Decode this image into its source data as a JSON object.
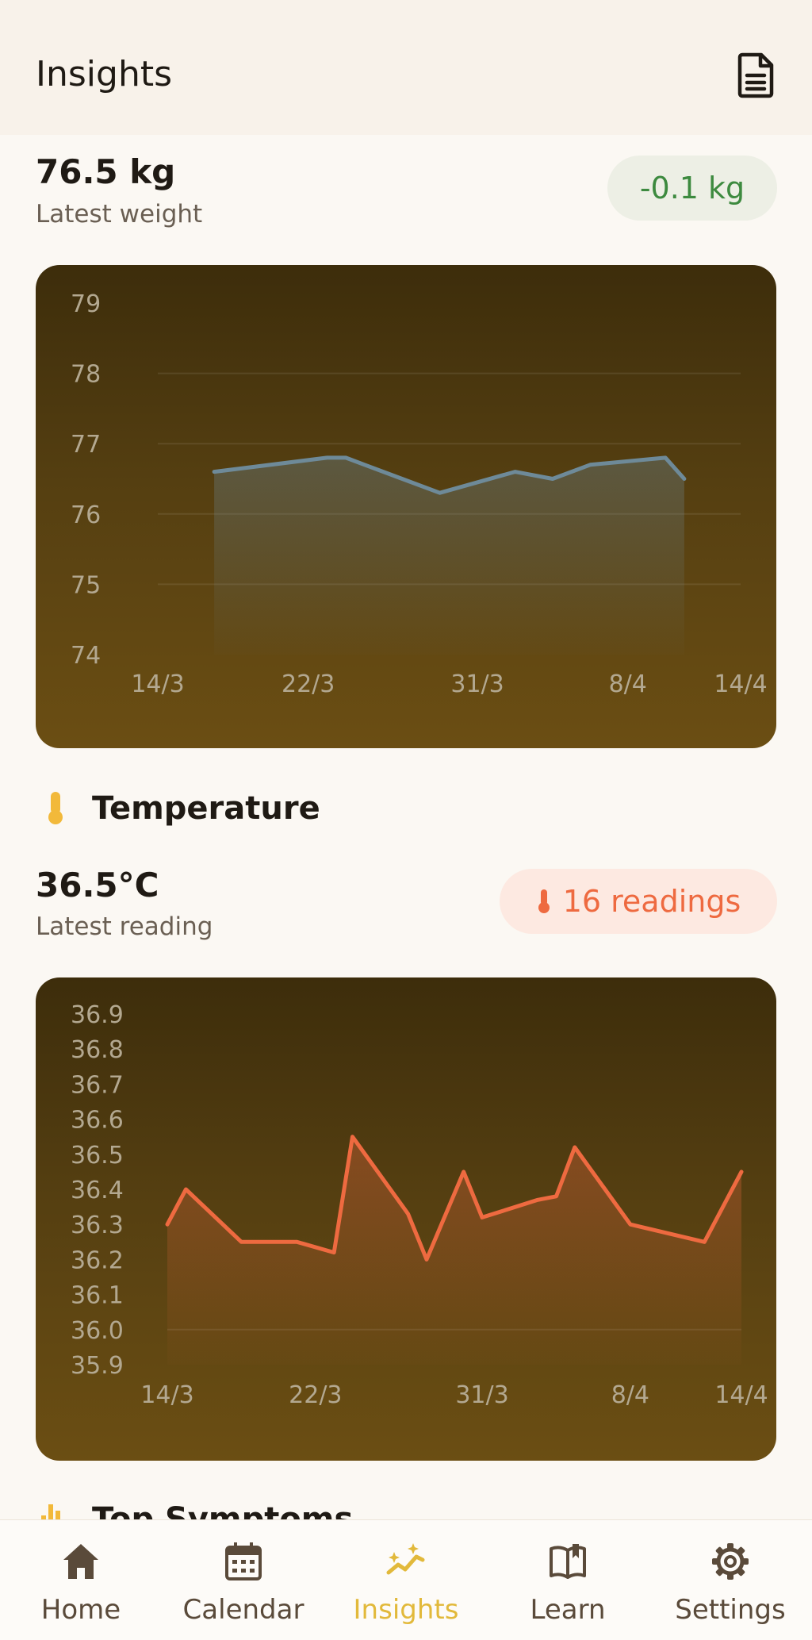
{
  "header": {
    "title": "Insights",
    "icon": "document-icon"
  },
  "weight": {
    "value": "76.5 kg",
    "label": "Latest weight",
    "change": "-0.1 kg",
    "change_color": "#3d8a3f"
  },
  "temperature": {
    "section_title": "Temperature",
    "value": "36.5°C",
    "label": "Latest reading",
    "readings": "16 readings",
    "accent": "#ee6a40",
    "icon_color": "#f2b93a"
  },
  "next_section": {
    "title": "Top Symptoms"
  },
  "chart_data": [
    {
      "type": "area",
      "title": "",
      "x_ticks": [
        "14/3",
        "22/3",
        "31/3",
        "8/4",
        "14/4"
      ],
      "y_ticks": [
        "79",
        "78",
        "77",
        "76",
        "75",
        "74"
      ],
      "ylim": [
        74,
        79
      ],
      "x": [
        "17/3",
        "23/3",
        "24/3",
        "25/3",
        "29/3",
        "2/4",
        "4/4",
        "6/4",
        "10/4",
        "11/4"
      ],
      "values": [
        76.6,
        76.8,
        76.8,
        76.7,
        76.3,
        76.6,
        76.5,
        76.7,
        76.8,
        76.5
      ],
      "line_color": "#6e8a99",
      "grid": true
    },
    {
      "type": "area",
      "title": "",
      "x_ticks": [
        "14/3",
        "22/3",
        "31/3",
        "8/4",
        "14/4"
      ],
      "y_ticks": [
        "36.9",
        "36.8",
        "36.7",
        "36.6",
        "36.5",
        "36.4",
        "36.3",
        "36.2",
        "36.1",
        "36.0",
        "35.9"
      ],
      "ylim": [
        35.9,
        36.9
      ],
      "x": [
        "14/3",
        "15/3",
        "18/3",
        "21/3",
        "23/3",
        "24/3",
        "27/3",
        "28/3",
        "30/3",
        "31/3",
        "3/4",
        "4/4",
        "5/4",
        "8/4",
        "12/4",
        "14/4"
      ],
      "values": [
        36.3,
        36.4,
        36.25,
        36.25,
        36.22,
        36.55,
        36.33,
        36.2,
        36.45,
        36.32,
        36.37,
        36.38,
        36.52,
        36.3,
        36.25,
        36.45
      ],
      "line_color": "#ee6a40",
      "grid": true
    }
  ],
  "nav": {
    "items": [
      {
        "label": "Home",
        "icon": "home-icon"
      },
      {
        "label": "Calendar",
        "icon": "calendar-icon"
      },
      {
        "label": "Insights",
        "icon": "insights-icon",
        "active": true
      },
      {
        "label": "Learn",
        "icon": "book-icon"
      },
      {
        "label": "Settings",
        "icon": "gear-icon"
      }
    ],
    "active_color": "#e2b93b",
    "inactive_color": "#5a4a3a"
  }
}
